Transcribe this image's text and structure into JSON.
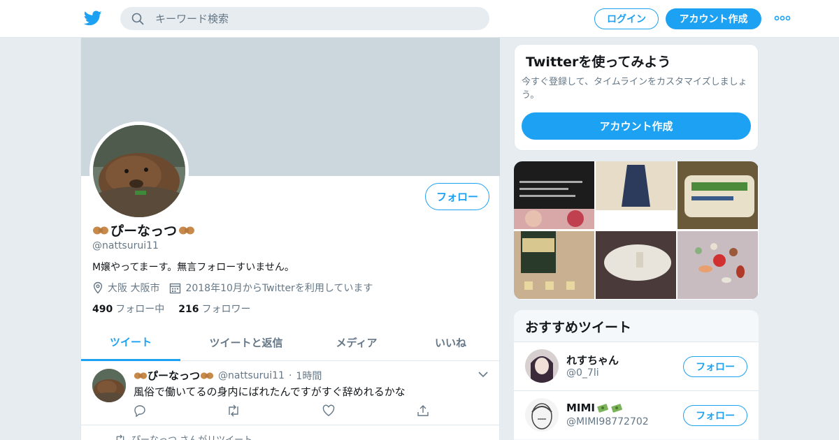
{
  "topbar": {
    "search_placeholder": "キーワード検索",
    "login_label": "ログイン",
    "signup_label": "アカウント作成"
  },
  "profile": {
    "name": "ぴーなっつ",
    "name_emoji": "peanut-icon",
    "handle": "@nattsurui11",
    "follow_label": "フォロー",
    "bio": "M嬢やってまーす。無言フォローすいません。",
    "location": "大阪 大阪市",
    "joined": "2018年10月からTwitterを利用しています",
    "following_count": "490",
    "following_label": "フォロー中",
    "followers_count": "216",
    "followers_label": "フォロワー"
  },
  "tabs": [
    {
      "label": "ツイート",
      "active": true
    },
    {
      "label": "ツイートと返信",
      "active": false
    },
    {
      "label": "メディア",
      "active": false
    },
    {
      "label": "いいね",
      "active": false
    }
  ],
  "tweet": {
    "name": "ぴーなっつ",
    "handle": "@nattsurui11",
    "separator": "·",
    "time": "1時間",
    "text": "風俗で働いてるの身内にばれたんですがすぐ辞めれるかな",
    "retweet_note": "ぴーなっつ さんがリツイート"
  },
  "sidebar": {
    "signup_card": {
      "title": "Twitterを使ってみよう",
      "description": "今すぐ登録して、タイムラインをカスタマイズしましょう。",
      "button_label": "アカウント作成"
    },
    "recommended": {
      "title": "おすすめツイート",
      "items": [
        {
          "name": "れすちゃん",
          "handle": "@0_7li",
          "follow_label": "フォロー"
        },
        {
          "name": "MIMI",
          "handle": "@MIMI98772702",
          "follow_label": "フォロー"
        }
      ]
    }
  },
  "colors": {
    "brand": "#1da1f2",
    "banner": "#ccd6dd",
    "muted": "#657786"
  }
}
